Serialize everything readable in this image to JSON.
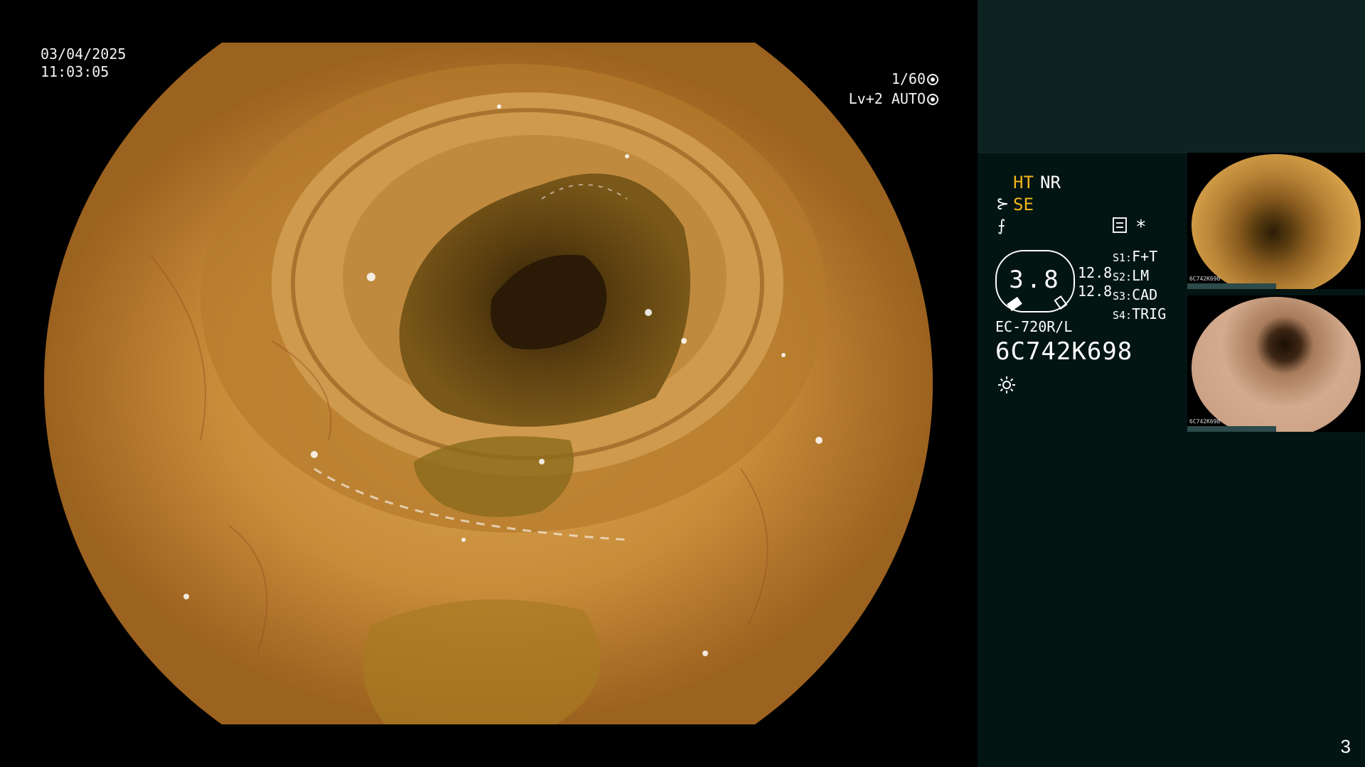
{
  "overlay": {
    "date": "03/04/2025",
    "time": "11:03:05",
    "shutter": "1/60",
    "level": "Lv+2 AUTO"
  },
  "panel": {
    "ht": "HT",
    "nr": "NR",
    "se": "SE",
    "gauge_value": "3.8",
    "gauge_num_1": "12.8",
    "gauge_num_2": "12.8",
    "slots": [
      {
        "key": "S1:",
        "value": "F+T"
      },
      {
        "key": "S2:",
        "value": "LM"
      },
      {
        "key": "S3:",
        "value": "CAD"
      },
      {
        "key": "S4:",
        "value": "TRIG"
      }
    ],
    "scope_model": "EC-720R/L",
    "serial": "6C742K698"
  },
  "thumbnails": [
    {
      "tag": "6C742K698"
    },
    {
      "tag": "6C742K698"
    }
  ],
  "page_number": "3",
  "colors": {
    "accent_yellow": "#f2b31c",
    "panel_bg": "#031513",
    "panel_top": "#0d2322"
  },
  "icons": [
    "shutter-icon",
    "auto-iris-icon",
    "se-scope-icon",
    "flash-icon",
    "menu-icon",
    "asterisk-icon",
    "sun-icon"
  ]
}
